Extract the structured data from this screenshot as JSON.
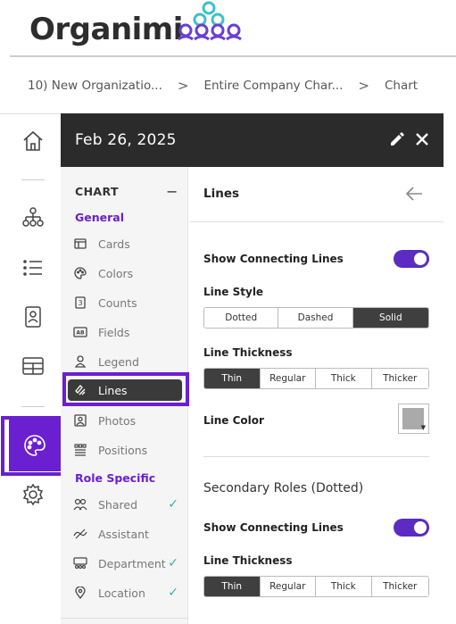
{
  "app": {
    "logo_text": "Organimi",
    "colors": {
      "accent": "#6a1fd0",
      "toggle": "#5b2bc2",
      "header_bg": "#2b2b2b",
      "check": "#33b3a0",
      "logo_cyan": "#3fc1c9",
      "logo_purple": "#6a3fd0"
    }
  },
  "breadcrumb": {
    "items": [
      "10) New Organizatio...",
      "Entire Company Char...",
      "Chart"
    ],
    "separator": ">"
  },
  "rail": {
    "icons": [
      "home-icon",
      "org-chart-icon",
      "list-icon",
      "profile-card-icon",
      "table-icon",
      "palette-icon",
      "settings-icon"
    ],
    "active": "palette-icon"
  },
  "panel": {
    "date": "Feb 26, 2025",
    "edit_icon": "pencil-icon",
    "close_icon": "close-icon"
  },
  "leftnav": {
    "section_title": "CHART",
    "collapse_symbol": "−",
    "groups": {
      "general": "General",
      "role_specific": "Role Specific"
    },
    "general_items": [
      {
        "label": "Cards",
        "icon": "cards-icon"
      },
      {
        "label": "Colors",
        "icon": "palette-icon"
      },
      {
        "label": "Counts",
        "icon": "counter-icon"
      },
      {
        "label": "Fields",
        "icon": "fields-icon"
      },
      {
        "label": "Legend",
        "icon": "person-icon"
      },
      {
        "label": "Lines",
        "icon": "lines-icon",
        "active": true
      },
      {
        "label": "Photos",
        "icon": "photo-icon"
      },
      {
        "label": "Positions",
        "icon": "positions-icon"
      }
    ],
    "role_items": [
      {
        "label": "Shared",
        "icon": "shared-icon",
        "checked": true
      },
      {
        "label": "Assistant",
        "icon": "assistant-icon",
        "checked": false
      },
      {
        "label": "Department",
        "icon": "department-icon",
        "checked": true
      },
      {
        "label": "Location",
        "icon": "location-icon",
        "checked": true
      }
    ],
    "check_symbol": "✓"
  },
  "content": {
    "title": "Lines",
    "back_icon": "arrow-left-icon",
    "show_connecting_lines_label": "Show Connecting Lines",
    "show_connecting_lines_on": true,
    "line_style_label": "Line Style",
    "line_style_options": [
      "Dotted",
      "Dashed",
      "Solid"
    ],
    "line_style_selected": "Solid",
    "line_thickness_label": "Line Thickness",
    "line_thickness_options": [
      "Thin",
      "Regular",
      "Thick",
      "Thicker"
    ],
    "line_thickness_selected": "Thin",
    "line_color_label": "Line Color",
    "line_color_value": "#aaaaaa",
    "secondary_title": "Secondary Roles (Dotted)",
    "secondary_show_connecting_lines_label": "Show Connecting Lines",
    "secondary_show_connecting_lines_on": true,
    "secondary_line_thickness_label": "Line Thickness",
    "secondary_line_thickness_options": [
      "Thin",
      "Regular",
      "Thick",
      "Thicker"
    ],
    "secondary_line_thickness_selected": "Thin"
  }
}
